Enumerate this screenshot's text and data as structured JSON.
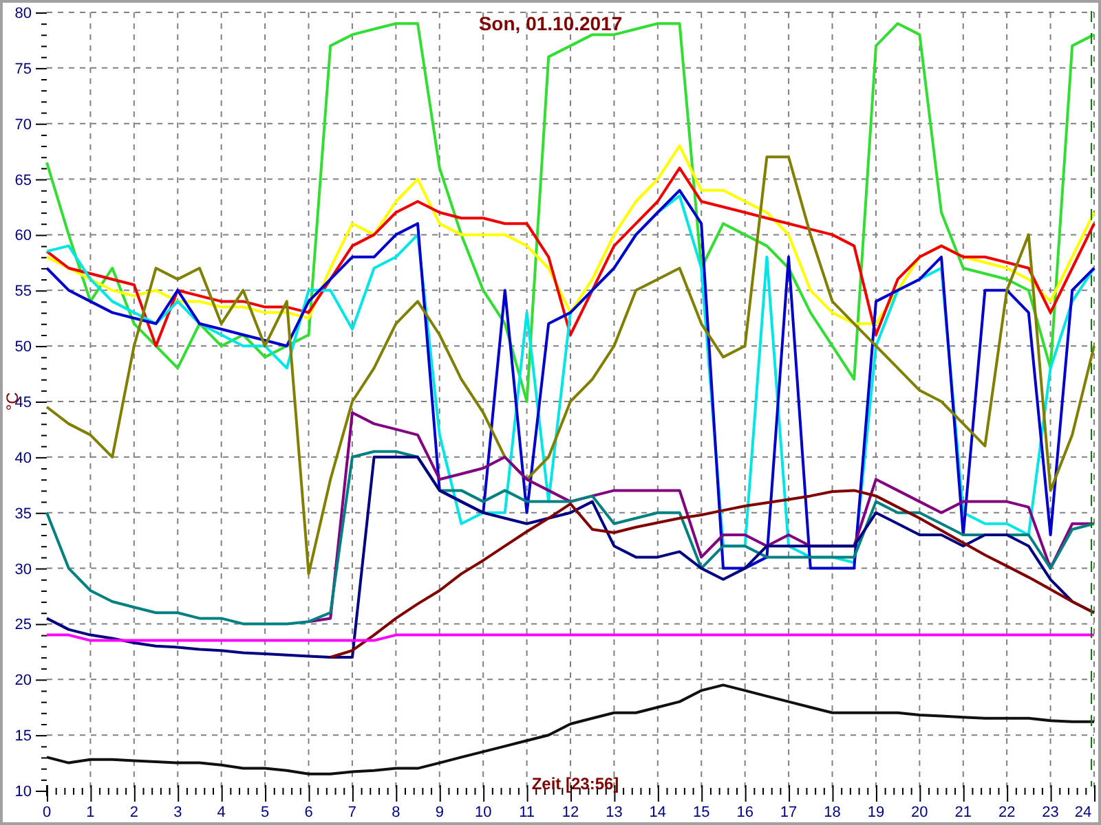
{
  "chart_data": {
    "type": "line",
    "grid": true,
    "title": "Son, 01.10.2017",
    "xlabel": "Zeit [23:56]",
    "ylabel": "°C",
    "xlim": [
      0,
      24
    ],
    "ylim": [
      10,
      80
    ],
    "xticks": [
      0,
      1,
      2,
      3,
      4,
      5,
      6,
      7,
      8,
      9,
      10,
      11,
      12,
      13,
      14,
      15,
      16,
      17,
      18,
      19,
      20,
      21,
      22,
      23,
      24
    ],
    "yticks": [
      10,
      15,
      20,
      25,
      30,
      35,
      40,
      45,
      50,
      55,
      60,
      65,
      70,
      75,
      80
    ],
    "x": [
      0,
      0.5,
      1,
      1.5,
      2,
      2.5,
      3,
      3.5,
      4,
      4.5,
      5,
      5.5,
      6,
      6.5,
      7,
      7.5,
      8,
      8.5,
      9,
      9.5,
      10,
      10.5,
      11,
      11.5,
      12,
      12.5,
      13,
      13.5,
      14,
      14.5,
      15,
      15.5,
      16,
      16.5,
      17,
      17.5,
      18,
      18.5,
      19,
      19.5,
      20,
      20.5,
      21,
      21.5,
      22,
      22.5,
      23,
      23.5,
      24
    ],
    "series": [
      {
        "color": "#33dd33",
        "values": [
          66.5,
          60,
          54,
          57,
          52,
          50,
          48,
          52,
          50,
          51,
          49,
          50,
          51,
          77,
          78,
          78.5,
          79,
          79,
          66,
          60,
          55,
          52,
          45,
          76,
          77,
          78,
          78,
          78.5,
          79,
          79,
          57,
          61,
          60,
          59,
          57,
          53,
          50,
          47,
          77,
          79,
          78,
          62,
          57,
          56.5,
          56,
          55,
          48,
          77,
          78
        ]
      },
      {
        "color": "#ffff00",
        "values": [
          58,
          57,
          56,
          55,
          54.5,
          55,
          54,
          54,
          53.5,
          53.5,
          53,
          53,
          52.5,
          57,
          61,
          60,
          63,
          65,
          61,
          60,
          60,
          60,
          59,
          57,
          53,
          56,
          60,
          63,
          65,
          68,
          64,
          64,
          63,
          62,
          60,
          55,
          53,
          52,
          52,
          55,
          58,
          59,
          58,
          57.5,
          57,
          56,
          54,
          58,
          62
        ]
      },
      {
        "color": "#ee0000",
        "values": [
          58.5,
          57,
          56.5,
          56,
          55.5,
          50,
          55,
          54.5,
          54,
          54,
          53.5,
          53.5,
          53,
          56,
          59,
          60,
          62,
          63,
          62,
          61.5,
          61.5,
          61,
          61,
          58,
          51,
          55,
          59,
          61,
          63,
          66,
          63,
          62.5,
          62,
          61.5,
          61,
          60.5,
          60,
          59,
          51,
          56,
          58,
          59,
          58,
          58,
          57.5,
          57,
          53,
          57,
          61
        ]
      },
      {
        "color": "#00e5e5",
        "values": [
          58.5,
          59,
          56,
          54,
          53,
          52,
          54,
          52,
          51,
          50,
          50,
          48,
          55,
          55,
          51.5,
          57,
          58,
          60,
          42,
          34,
          35,
          35,
          53,
          36,
          53,
          55,
          57,
          60,
          62,
          63.5,
          57,
          32,
          32,
          58,
          32,
          31,
          31,
          30.5,
          50,
          55,
          56,
          57,
          35,
          34,
          34,
          33,
          48,
          54,
          57
        ]
      },
      {
        "color": "#0000cc",
        "values": [
          57,
          55,
          54,
          53,
          52.5,
          52,
          55,
          52,
          51.5,
          51,
          50.5,
          50,
          54,
          56,
          58,
          58,
          60,
          61,
          37,
          36,
          35,
          55,
          35,
          52,
          53,
          55,
          57,
          60,
          62,
          64,
          61,
          30,
          30,
          31,
          58,
          30,
          30,
          30,
          54,
          55,
          56,
          58,
          33,
          55,
          55,
          53,
          33,
          55,
          57
        ]
      },
      {
        "color": "#808000",
        "values": [
          44.5,
          43,
          42,
          40,
          50,
          57,
          56,
          57,
          52,
          55,
          50,
          54,
          29.5,
          38,
          45,
          48,
          52,
          54,
          51,
          47,
          44,
          40,
          38,
          40,
          45,
          47,
          50,
          55,
          56,
          57,
          52,
          49,
          50,
          67,
          67,
          60,
          54,
          52,
          50,
          48,
          46,
          45,
          43,
          41,
          55,
          60,
          37,
          42,
          50
        ]
      },
      {
        "color": "#800080",
        "values": [
          null,
          null,
          null,
          null,
          null,
          null,
          null,
          null,
          null,
          null,
          null,
          null,
          25.2,
          25.5,
          44,
          43,
          42.5,
          42,
          38,
          38.5,
          39,
          40,
          38,
          37,
          36,
          36.5,
          37,
          37,
          37,
          37,
          31,
          33,
          33,
          32,
          33,
          32,
          32,
          32,
          38,
          37,
          36,
          35,
          36,
          36,
          36,
          35.5,
          30,
          34,
          34
        ]
      },
      {
        "color": "#008080",
        "values": [
          35,
          30,
          28,
          27,
          26.5,
          26,
          26,
          25.5,
          25.5,
          25,
          25,
          25,
          25.2,
          26,
          40,
          40.5,
          40.5,
          40,
          37,
          37,
          36,
          37,
          36,
          36,
          36,
          36.5,
          34,
          34.5,
          35,
          35,
          30,
          32,
          32,
          31,
          31,
          31,
          31,
          31,
          36,
          35,
          35,
          34,
          33,
          33,
          33,
          33,
          30,
          33.5,
          34
        ]
      },
      {
        "color": "#000080",
        "values": [
          25.5,
          24.5,
          24,
          23.7,
          23.3,
          23,
          22.9,
          22.7,
          22.6,
          22.4,
          22.3,
          22.2,
          22.1,
          22,
          22,
          40,
          40,
          40,
          37,
          36,
          35,
          34.5,
          34,
          34.5,
          35,
          36,
          32,
          31,
          31,
          31.5,
          30,
          29,
          30,
          32,
          32,
          32,
          32,
          32,
          35,
          34,
          33,
          33,
          32,
          33,
          33,
          32,
          29,
          27,
          26
        ]
      },
      {
        "color": "#800000",
        "values": [
          null,
          null,
          null,
          null,
          null,
          null,
          null,
          null,
          null,
          null,
          null,
          null,
          null,
          22,
          22.6,
          24,
          25.5,
          26.8,
          28,
          29.5,
          30.7,
          32,
          33.3,
          34.5,
          35.8,
          33.5,
          33.2,
          33.7,
          34.1,
          34.5,
          34.8,
          35.2,
          35.6,
          35.9,
          36.2,
          36.5,
          36.9,
          37,
          36.5,
          35.5,
          34.5,
          33.4,
          32.3,
          31.2,
          30.2,
          29.2,
          28.1,
          27,
          26
        ]
      },
      {
        "color": "#ff00ff",
        "values": [
          24,
          24,
          23.5,
          23.5,
          23.5,
          23.5,
          23.5,
          23.5,
          23.5,
          23.5,
          23.5,
          23.5,
          23.5,
          23.5,
          23.5,
          23.5,
          24,
          24,
          24,
          24,
          24,
          24,
          24,
          24,
          24,
          24,
          24,
          24,
          24,
          24,
          24,
          24,
          24,
          24,
          24,
          24,
          24,
          24,
          24,
          24,
          24,
          24,
          24,
          24,
          24,
          24,
          24,
          24,
          24
        ]
      },
      {
        "color": "#101010",
        "values": [
          13,
          12.5,
          12.8,
          12.8,
          12.7,
          12.6,
          12.5,
          12.5,
          12.3,
          12,
          12,
          11.8,
          11.5,
          11.5,
          11.7,
          11.8,
          12,
          12,
          12.5,
          13,
          13.5,
          14,
          14.5,
          15,
          16,
          16.5,
          17,
          17,
          17.5,
          18,
          19,
          19.5,
          19,
          18.5,
          18,
          17.5,
          17,
          17,
          17,
          17,
          16.8,
          16.7,
          16.6,
          16.5,
          16.5,
          16.5,
          16.3,
          16.2,
          16.2
        ]
      }
    ]
  }
}
